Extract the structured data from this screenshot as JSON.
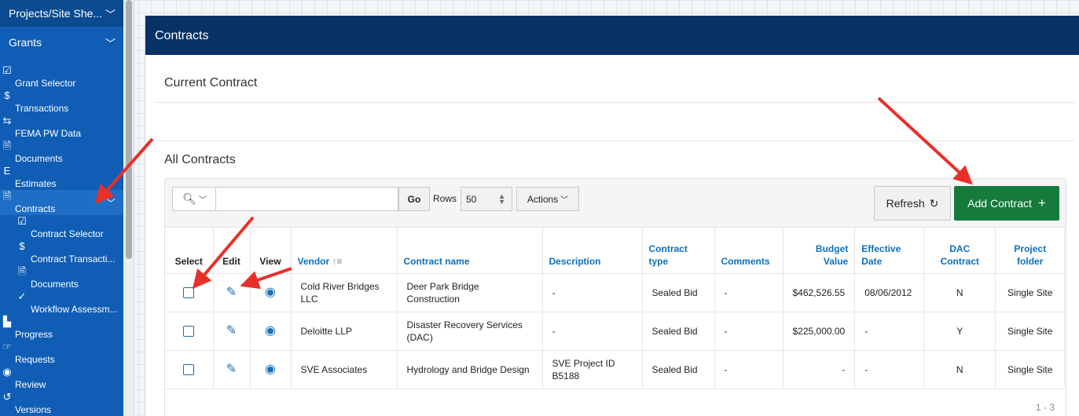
{
  "sidebar": {
    "top": {
      "label": "Projects/Site She...",
      "icon": "chevron-down-icon"
    },
    "grants": {
      "label": "Grants",
      "icon": "chevron-down-icon"
    },
    "items": [
      {
        "label": "Grant Selector",
        "icon": "check-square-icon",
        "glyph": "☑"
      },
      {
        "label": "Transactions",
        "icon": "dollar-icon",
        "glyph": "$"
      },
      {
        "label": "FEMA PW Data",
        "icon": "arrows-exchange-icon",
        "glyph": "⇆"
      },
      {
        "label": "Documents",
        "icon": "pdf-icon",
        "glyph": "🗎"
      },
      {
        "label": "Estimates",
        "icon": "estimate-icon",
        "glyph": "E"
      },
      {
        "label": "Contracts",
        "icon": "document-icon",
        "glyph": "🗎"
      },
      {
        "label": "Contract Selector",
        "icon": "check-square-icon",
        "glyph": "☑"
      },
      {
        "label": "Contract Transacti...",
        "icon": "dollar-icon",
        "glyph": "$"
      },
      {
        "label": "Documents",
        "icon": "pdf-icon",
        "glyph": "🗎"
      },
      {
        "label": "Workflow Assessm...",
        "icon": "checkmark-icon",
        "glyph": "✓"
      },
      {
        "label": "Progress",
        "icon": "bar-chart-icon",
        "glyph": "▙"
      },
      {
        "label": "Requests",
        "icon": "hand-point-icon",
        "glyph": "☞"
      },
      {
        "label": "Review",
        "icon": "eye-icon",
        "glyph": "◉"
      },
      {
        "label": "Versions",
        "icon": "history-icon",
        "glyph": "↺"
      }
    ]
  },
  "page": {
    "title": "Contracts",
    "current_contract": "Current Contract",
    "all_contracts": "All Contracts"
  },
  "toolbar": {
    "go": "Go",
    "rows_label": "Rows",
    "rows_value": "50",
    "actions": "Actions",
    "refresh": "Refresh",
    "add_contract": "Add Contract"
  },
  "table": {
    "headers": {
      "select": "Select",
      "edit": "Edit",
      "view": "View",
      "vendor": "Vendor",
      "contract_name": "Contract name",
      "description": "Description",
      "contract_type": "Contract type",
      "comments": "Comments",
      "budget_value": "Budget Value",
      "effective_date": "Effective Date",
      "dac_contract": "DAC Contract",
      "project_folder": "Project folder"
    },
    "rows": [
      {
        "vendor": "Cold River Bridges LLC",
        "contract_name": "Deer Park Bridge Construction",
        "description": "-",
        "contract_type": "Sealed Bid",
        "comments": "-",
        "budget_value": "$462,526.55",
        "effective_date": "08/06/2012",
        "dac_contract": "N",
        "project_folder": "Single Site"
      },
      {
        "vendor": "Deloitte LLP",
        "contract_name": "Disaster Recovery Services (DAC)",
        "description": "-",
        "contract_type": "Sealed Bid",
        "comments": "-",
        "budget_value": "$225,000.00",
        "effective_date": "-",
        "dac_contract": "Y",
        "project_folder": "Single Site"
      },
      {
        "vendor": "SVE Associates",
        "contract_name": "Hydrology and Bridge Design",
        "description": "SVE Project ID B5188",
        "contract_type": "Sealed Bid",
        "comments": "-",
        "budget_value": "-",
        "effective_date": "-",
        "dac_contract": "N",
        "project_folder": "Single Site"
      }
    ],
    "pagination": "1 - 3"
  },
  "colors": {
    "sidebar": "#0f5db5",
    "header": "#063266",
    "add_button": "#147b3c",
    "link": "#0a70c0",
    "annotation_arrow": "#e8302a"
  }
}
